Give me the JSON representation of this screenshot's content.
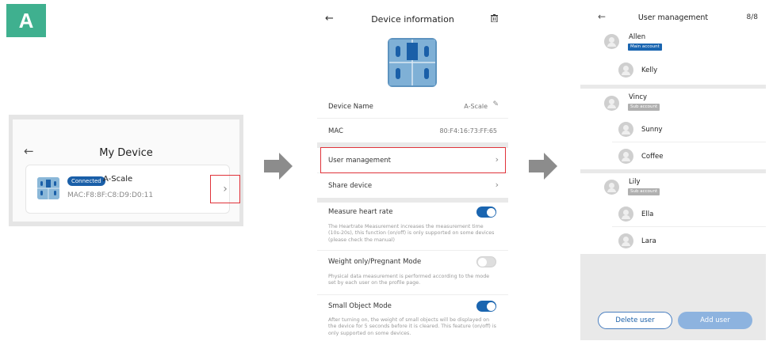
{
  "panel_label": "A",
  "screen1": {
    "back_icon": "arrow-left-icon",
    "title": "My Device",
    "device": {
      "status": "Connected",
      "name": "A-Scale",
      "mac": "MAC:F8:8F:C8:D9:D0:11"
    }
  },
  "screen2": {
    "title": "Device information",
    "rows": {
      "device_name_label": "Device Name",
      "device_name_value": "A-Scale",
      "mac_label": "MAC",
      "mac_value": "80:F4:16:73:FF:65",
      "user_management": "User management",
      "share_device": "Share device"
    },
    "settings": [
      {
        "label": "Measure heart rate",
        "on": true,
        "desc": "The Heartrate Measurement increases the measurement time (10s-20s), this function (on/off) is only supported on some devices (please check the manual)"
      },
      {
        "label": "Weight only/Pregnant Mode",
        "on": false,
        "desc": "Physical data measurement is performed according to the mode set by each user on the profile page."
      },
      {
        "label": "Small Object Mode",
        "on": true,
        "desc": "After turning on, the weight of small objects will be displayed on the device for 5 seconds before it is cleared. This feature (on/off) is only supported on some devices."
      }
    ],
    "accent": "#1a65b0"
  },
  "screen3": {
    "title": "User management",
    "count": "8/8",
    "groups": [
      {
        "main": "Allen",
        "tag": "Main account",
        "subs": [
          "Kelly"
        ]
      },
      {
        "main": "Vincy",
        "tag": "Sub account",
        "subs": [
          "Sunny",
          "Coffee"
        ]
      },
      {
        "main": "Lily",
        "tag": "Sub account",
        "subs": [
          "Ella",
          "Lara"
        ]
      }
    ],
    "delete_label": "Delete user",
    "add_label": "Add user"
  },
  "highlight_color": "#e0333a"
}
